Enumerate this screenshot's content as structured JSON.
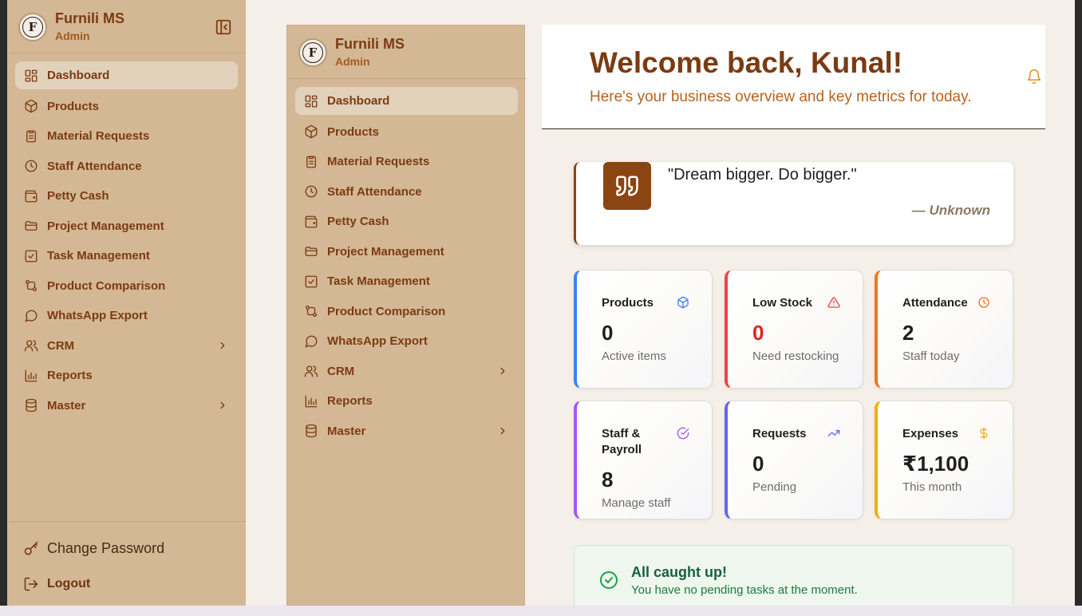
{
  "app": {
    "name": "Furnili MS",
    "role": "Admin",
    "logo_letter": "F"
  },
  "nav": [
    {
      "label": "Dashboard",
      "icon": "dashboard-icon",
      "active": true
    },
    {
      "label": "Products",
      "icon": "box-icon"
    },
    {
      "label": "Material Requests",
      "icon": "clipboard-icon"
    },
    {
      "label": "Staff Attendance",
      "icon": "clock-icon"
    },
    {
      "label": "Petty Cash",
      "icon": "wallet-icon"
    },
    {
      "label": "Project Management",
      "icon": "folder-icon"
    },
    {
      "label": "Task Management",
      "icon": "checkbox-icon"
    },
    {
      "label": "Product Comparison",
      "icon": "git-compare-icon"
    },
    {
      "label": "WhatsApp Export",
      "icon": "chat-icon"
    },
    {
      "label": "CRM",
      "icon": "users-icon",
      "expandable": true
    },
    {
      "label": "Reports",
      "icon": "bar-chart-icon"
    },
    {
      "label": "Master",
      "icon": "database-icon",
      "expandable": true
    }
  ],
  "footer": {
    "change_password": "Change Password",
    "logout": "Logout"
  },
  "header": {
    "welcome": "Welcome back, Kunal!",
    "subtitle": "Here's your business overview and key metrics for today."
  },
  "quote": {
    "text": "\"Dream bigger. Do bigger.\"",
    "author": "— Unknown"
  },
  "stats": [
    {
      "label": "Products",
      "value": "0",
      "desc": "Active items",
      "accent": "#3b82f6",
      "icon": "box-icon",
      "value_color": "#1f1f1f"
    },
    {
      "label": "Low Stock",
      "value": "0",
      "desc": "Need restocking",
      "accent": "#ef4444",
      "icon": "warning-icon",
      "value_color": "#dc2626"
    },
    {
      "label": "Attendance",
      "value": "2",
      "desc": "Staff today",
      "accent": "#f97316",
      "icon": "clock-icon",
      "value_color": "#1f1f1f"
    },
    {
      "label": "Staff & Payroll",
      "value": "8",
      "desc": "Manage staff",
      "accent": "#a855f7",
      "icon": "check-circle-icon",
      "value_color": "#1f1f1f"
    },
    {
      "label": "Requests",
      "value": "0",
      "desc": "Pending",
      "accent": "#6366f1",
      "icon": "trending-up-icon",
      "value_color": "#1f1f1f"
    },
    {
      "label": "Expenses",
      "value": "₹1,100",
      "desc": "This month",
      "accent": "#eab308",
      "icon": "dollar-icon",
      "value_color": "#1f1f1f"
    }
  ],
  "caught_up": {
    "title": "All caught up!",
    "subtitle": "You have no pending tasks at the moment."
  },
  "colors": {
    "sidebar": "#d4b896",
    "brand": "#7b3b12",
    "background": "#f4efe8"
  }
}
